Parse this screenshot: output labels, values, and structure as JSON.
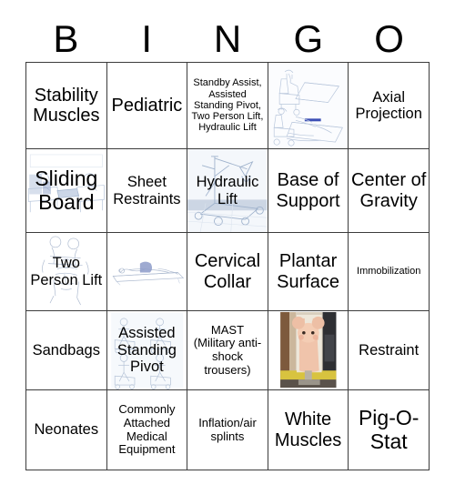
{
  "document": {
    "type": "bingo-card",
    "title": "BINGO"
  },
  "header": {
    "letters": [
      "B",
      "I",
      "N",
      "G",
      "O"
    ]
  },
  "grid": {
    "columns": 5,
    "rows": 5,
    "cells": [
      [
        {
          "text": "Stability Muscles",
          "size": "lg",
          "art": "none"
        },
        {
          "text": "Pediatric",
          "size": "lg",
          "art": "none"
        },
        {
          "text": "Standby Assist, Assisted Standing Pivot, Two Person Lift, Hydraulic Lift",
          "size": "xs",
          "art": "none"
        },
        {
          "text": "",
          "size": "md",
          "art": "wheelchair-stretcher-transfer"
        },
        {
          "text": "Axial Projection",
          "size": "md",
          "art": "none"
        }
      ],
      [
        {
          "text": "Sliding Board",
          "size": "xl",
          "art": "sliding-board-transfer"
        },
        {
          "text": "Sheet Restraints",
          "size": "md",
          "art": "none"
        },
        {
          "text": "Hydraulic Lift",
          "size": "md",
          "art": "hydraulic-lift"
        },
        {
          "text": "Base of Support",
          "size": "lg",
          "art": "none"
        },
        {
          "text": "Center of Gravity",
          "size": "lg",
          "art": "none"
        }
      ],
      [
        {
          "text": "Two Person Lift",
          "size": "md",
          "art": "two-person-lift"
        },
        {
          "text": "",
          "size": "md",
          "art": "patient-supine-sheet"
        },
        {
          "text": "Cervical Collar",
          "size": "lg",
          "art": "none"
        },
        {
          "text": "Plantar Surface",
          "size": "lg",
          "art": "none"
        },
        {
          "text": "Immobilization",
          "size": "xs",
          "art": "none"
        }
      ],
      [
        {
          "text": "Sandbags",
          "size": "md",
          "art": "none"
        },
        {
          "text": "Assisted Standing Pivot",
          "size": "md",
          "art": "standing-pivot"
        },
        {
          "text": "MAST (Military anti-shock trousers)",
          "size": "sm",
          "art": "none"
        },
        {
          "text": "",
          "size": "md",
          "art": "pigostat-photo"
        },
        {
          "text": "Restraint",
          "size": "md",
          "art": "none"
        }
      ],
      [
        {
          "text": "Neonates",
          "size": "md",
          "art": "none"
        },
        {
          "text": "Commonly Attached Medical Equipment",
          "size": "sm",
          "art": "none"
        },
        {
          "text": "Inflation/air splints",
          "size": "sm",
          "art": "none"
        },
        {
          "text": "White Muscles",
          "size": "lg",
          "art": "none"
        },
        {
          "text": "Pig-O-Stat",
          "size": "xl",
          "art": "none"
        }
      ]
    ]
  },
  "colors": {
    "background": "#ffffff",
    "grid_line": "#3c3c3c",
    "text": "#000000",
    "artwork_line": "#9fb2cc",
    "artwork_accent": "#6b7fc0"
  }
}
